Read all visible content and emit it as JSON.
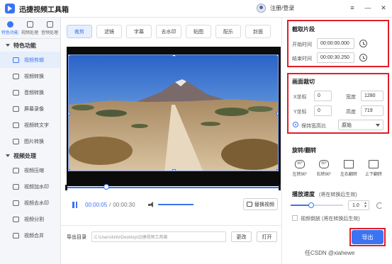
{
  "app": {
    "title": "迅捷视频工具箱",
    "login": "注册/登录"
  },
  "window": {
    "menu": "≡",
    "minimize": "—",
    "close": "✕"
  },
  "topnav": [
    {
      "label": "特色功能",
      "active": true
    },
    {
      "label": "视频处理",
      "active": false
    },
    {
      "label": "音频处理",
      "active": false
    }
  ],
  "sidebar": {
    "section1": "特色功能",
    "items1": [
      "视频剪辑",
      "视频转换",
      "音频转换",
      "屏幕录像",
      "视频转文字",
      "图片转换"
    ],
    "section2": "视频处理",
    "items2": [
      "视频压缩",
      "视频加水印",
      "视频去水印",
      "视频分割",
      "视频合并"
    ]
  },
  "tabs": [
    "裁剪",
    "滤镜",
    "字幕",
    "去水印",
    "贴图",
    "配乐",
    "封面"
  ],
  "player": {
    "current": "00:00:05",
    "separator": "/",
    "total": "00:00:30",
    "replace": "替换视频"
  },
  "output": {
    "label": "导出目录",
    "path": "C:\\Users\\linfu\\Desktop\\迅捷视频工具箱",
    "change": "更改",
    "open": "打开"
  },
  "clip": {
    "title": "截取片段",
    "start_label": "开始时间",
    "start": "00:00:00.000",
    "end_label": "结束时间",
    "end": "00:00:30.250"
  },
  "crop": {
    "title": "画面裁切",
    "x_label": "X坐标",
    "x": "0",
    "w_label": "宽度",
    "w": "1280",
    "y_label": "Y坐标",
    "y": "0",
    "h_label": "高度",
    "h": "719",
    "keep_ratio": "保持宽高比",
    "ratio": "原始"
  },
  "rotate": {
    "title": "旋转/翻转",
    "items": [
      "左转90°",
      "右转90°",
      "左右翻转",
      "上下翻转"
    ],
    "icons": [
      "90°",
      "90°",
      "",
      ""
    ]
  },
  "speed": {
    "title": "播放速度",
    "note": "(将在转换后生效)",
    "value": "1.0"
  },
  "reverse": {
    "label": "视频倒放",
    "note": "(将在转换后生效)"
  },
  "export": "导出",
  "watermark": "任CSDN @xiahewe",
  "colors": {
    "accent": "#3b74f2",
    "highlight": "#e11d2a"
  }
}
